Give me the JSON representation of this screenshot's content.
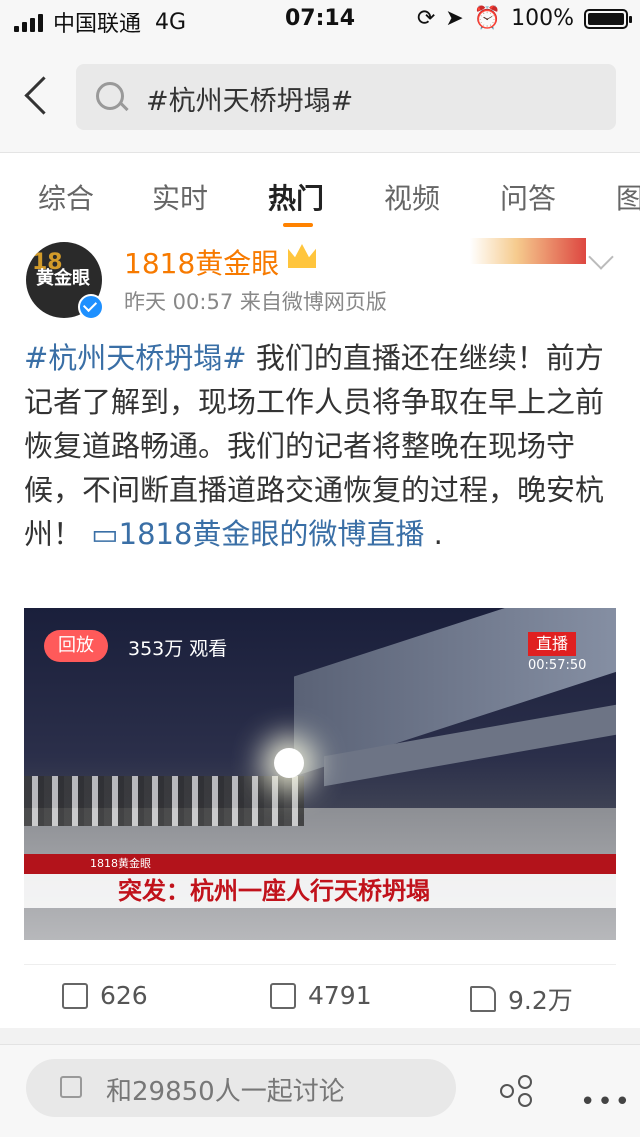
{
  "status_bar": {
    "carrier": "中国联通",
    "network": "4G",
    "time": "07:14",
    "battery": "100%",
    "battery_level": 1.0
  },
  "search": {
    "query": "#杭州天桥坍塌#"
  },
  "tabs": [
    {
      "label": "综合"
    },
    {
      "label": "实时"
    },
    {
      "label": "热门"
    },
    {
      "label": "视频"
    },
    {
      "label": "问答"
    },
    {
      "label": "图"
    }
  ],
  "post": {
    "username": "1818黄金眼",
    "avatar_text": "黄金眼",
    "avatar_number": "18",
    "meta": "昨天 00:57   来自微博网页版",
    "hashtag": "#杭州天桥坍塌#",
    "body": " 我们的直播还在继续！前方记者了解到，现场工作人员将争取在早上之前恢复道路畅通。我们的记者将整晚在现场守候，不间断直播道路交通恢复的过程，晚安杭州！ ",
    "live_link": "1818黄金眼的微博直播",
    "tail": " .",
    "video": {
      "replay_label": "回放",
      "views": "353万 观看",
      "live_label": "直播",
      "live_time": "00:57:50",
      "caption_source": "1818黄金眼",
      "caption_title": "突发：杭州一座人行天桥坍塌"
    },
    "actions": {
      "repost": "626",
      "comment": "4791",
      "like": "9.2万"
    }
  },
  "bottom": {
    "discuss_placeholder": "和29850人一起讨论",
    "more": "•••"
  }
}
